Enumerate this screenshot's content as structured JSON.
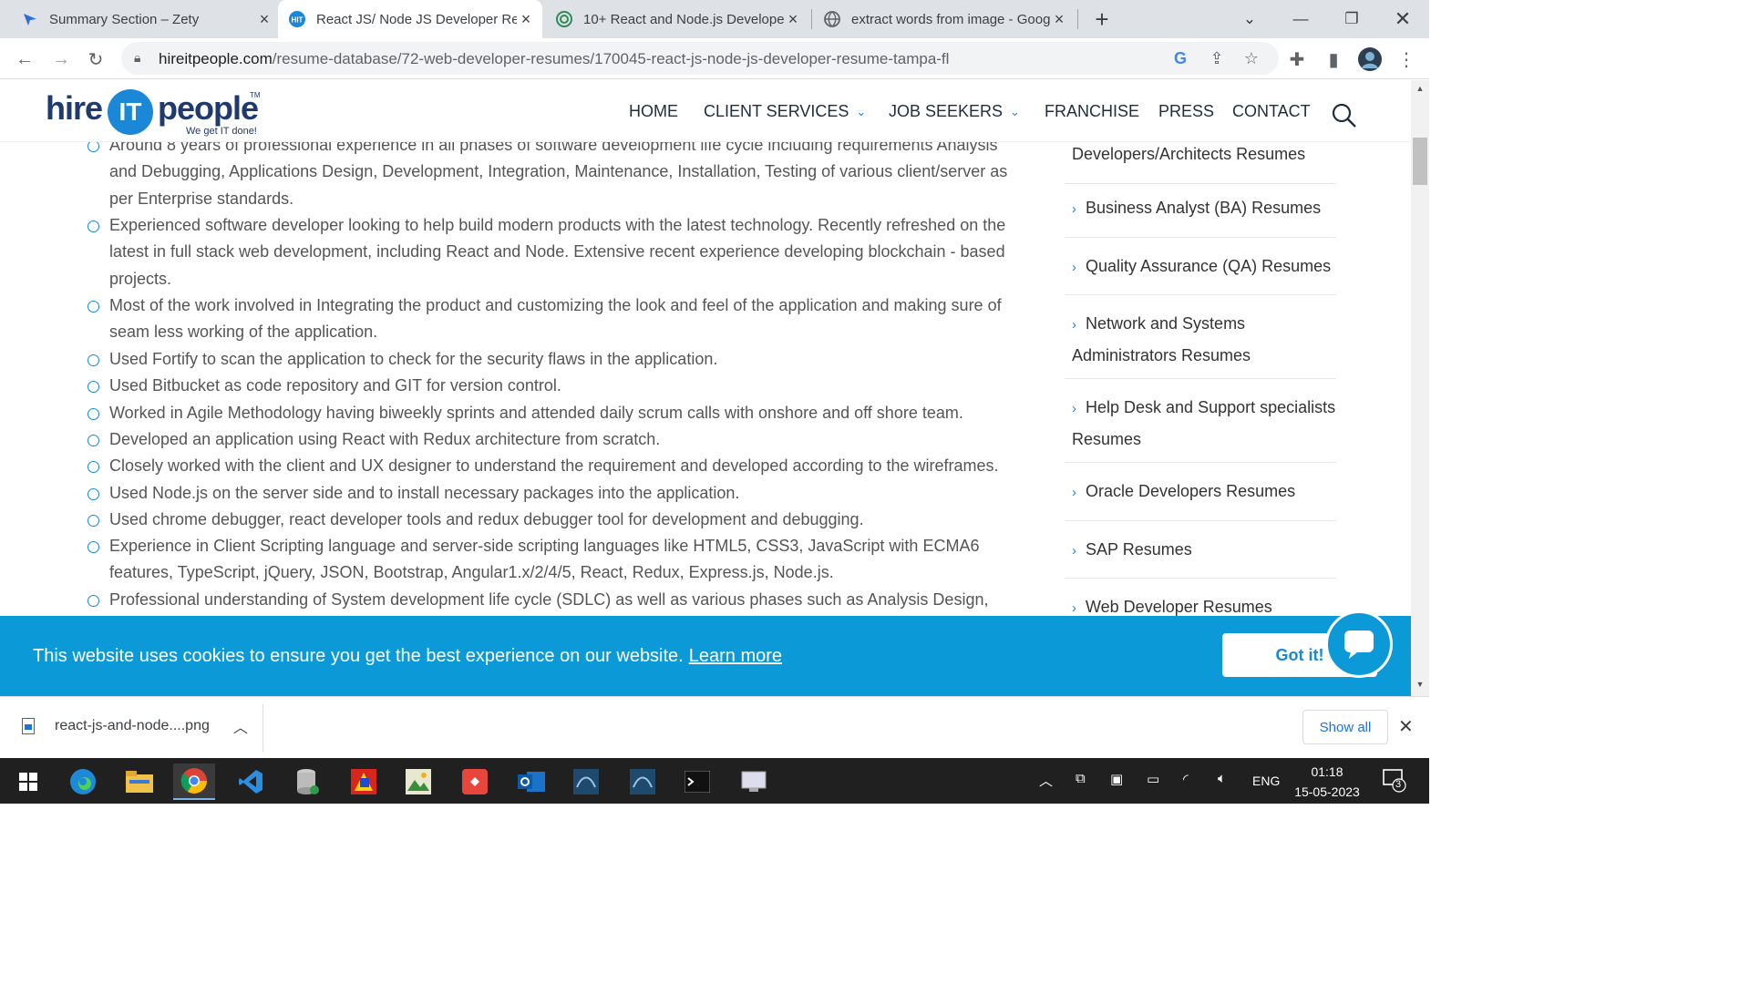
{
  "browser": {
    "tabs": [
      {
        "title": "Summary Section – Zety",
        "active": false
      },
      {
        "title": "React JS/ Node JS Developer Res",
        "active": true
      },
      {
        "title": "10+ React and Node.js Develope",
        "active": false
      },
      {
        "title": "extract words from image - Goog",
        "active": false
      }
    ],
    "url_domain": "hireitpeople.com",
    "url_path": "/resume-database/72-web-developer-resumes/170045-react-js-node-js-developer-resume-tampa-fl"
  },
  "site": {
    "logo": {
      "hire": "hire",
      "it": "IT",
      "people": "people",
      "tm": "TM",
      "tagline": "We get IT done!"
    },
    "nav": [
      "HOME",
      "CLIENT SERVICES",
      "JOB SEEKERS",
      "FRANCHISE",
      "PRESS",
      "CONTACT"
    ]
  },
  "content": {
    "paragraphs": [
      "Around 8 years of professional experience in all phases of software development life cycle including requirements Analysis and Debugging, Applications Design, Development, Integration, Maintenance, Installation, Testing of various client/server as per Enterprise standards.",
      "Experienced software developer looking to help build modern products with the latest technology. Recently refreshed on the latest in full stack web development, including React and Node. Extensive recent experience developing blockchain - based projects.",
      "Most of the work involved in Integrating the product and customizing the look and feel of the application and making sure of seam less working of the application.",
      "Used Fortify to scan the application to check for the security flaws in the application.",
      "Used Bitbucket as code repository and GIT for version control.",
      "Worked in Agile Methodology having biweekly sprints and attended daily scrum calls with onshore and off shore team.",
      "Developed an application using React with Redux architecture from scratch.",
      "Closely worked with the client and UX designer to understand the requirement and developed according to the wireframes.",
      "Used Node.js on the server side and to install necessary packages into the application.",
      "Used chrome debugger, react developer tools and redux debugger tool for development and debugging.",
      "Experience in Client Scripting language and server-side scripting languages like HTML5, CSS3, JavaScript with ECMA6 features, TypeScript, jQuery, JSON, Bootstrap, Angular1.x/2/4/5, React, Redux, Express.js, Node.js.",
      "Professional understanding of System development life cycle (SDLC) as well as various phases such as Analysis Design,"
    ],
    "sidebar": [
      "Developers/Architects Resumes",
      "Business Analyst (BA) Resumes",
      "Quality Assurance (QA) Resumes",
      "Network and Systems Administrators Resumes",
      "Help Desk and Support specialists Resumes",
      "Oracle Developers Resumes",
      "SAP Resumes",
      "Web Developer Resumes"
    ]
  },
  "cookie": {
    "message": "This website uses cookies to ensure you get the best experience on our website.",
    "learn_more": "Learn more",
    "button": "Got it!"
  },
  "downloads": {
    "file": "react-js-and-node....png",
    "show_all": "Show all"
  },
  "system": {
    "language": "ENG",
    "time": "01:18",
    "date": "15-05-2023",
    "notifications": "3"
  },
  "colors": {
    "accent": "#1a87d7",
    "cookie_bg": "#0b9ad7",
    "logo_navy": "#1f3a6e",
    "taskbar": "#202020"
  }
}
